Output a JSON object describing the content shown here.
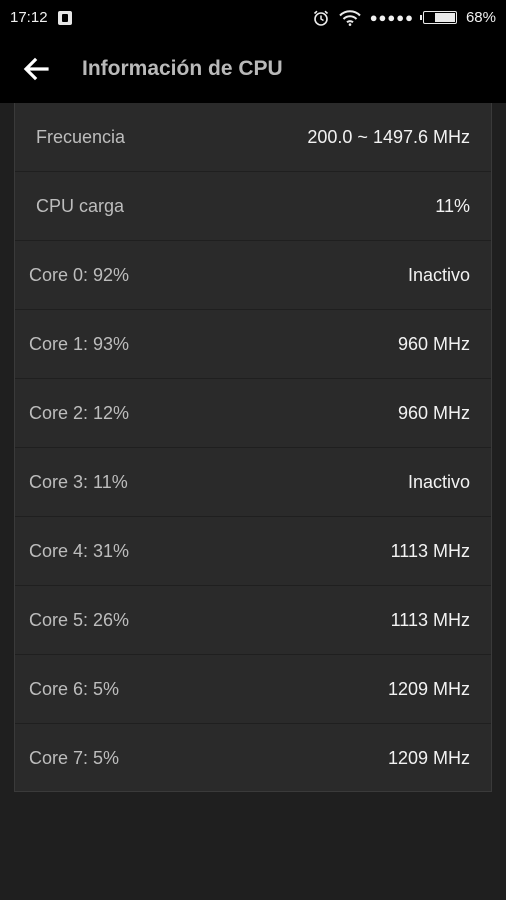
{
  "status_bar": {
    "time": "17:12",
    "battery_percent": "68%",
    "battery_level": 0.68,
    "signal_dots": "●●●●●",
    "icons": [
      "app-notification-icon",
      "alarm-icon",
      "wifi-icon",
      "signal-dots-icon",
      "battery-icon"
    ]
  },
  "app_bar": {
    "title": "Información de CPU",
    "back_icon": "arrow-left-icon"
  },
  "summary": [
    {
      "label": "Frecuencia",
      "value": "200.0 ~ 1497.6 MHz"
    },
    {
      "label": "CPU carga",
      "value": "11%"
    }
  ],
  "cores": [
    {
      "label": "Core 0: 92%",
      "value": "Inactivo"
    },
    {
      "label": "Core 1: 93%",
      "value": "960 MHz"
    },
    {
      "label": "Core 2: 12%",
      "value": "960 MHz"
    },
    {
      "label": "Core 3: 11%",
      "value": "Inactivo"
    },
    {
      "label": "Core 4: 31%",
      "value": "1113 MHz"
    },
    {
      "label": "Core 5: 26%",
      "value": "1113 MHz"
    },
    {
      "label": "Core 6: 5%",
      "value": "1209 MHz"
    },
    {
      "label": "Core 7: 5%",
      "value": "1209 MHz"
    }
  ],
  "colors": {
    "background": "#1f1f1f",
    "card": "#2a2a2a",
    "appbar": "#000000",
    "title": "#b9b9b9"
  }
}
